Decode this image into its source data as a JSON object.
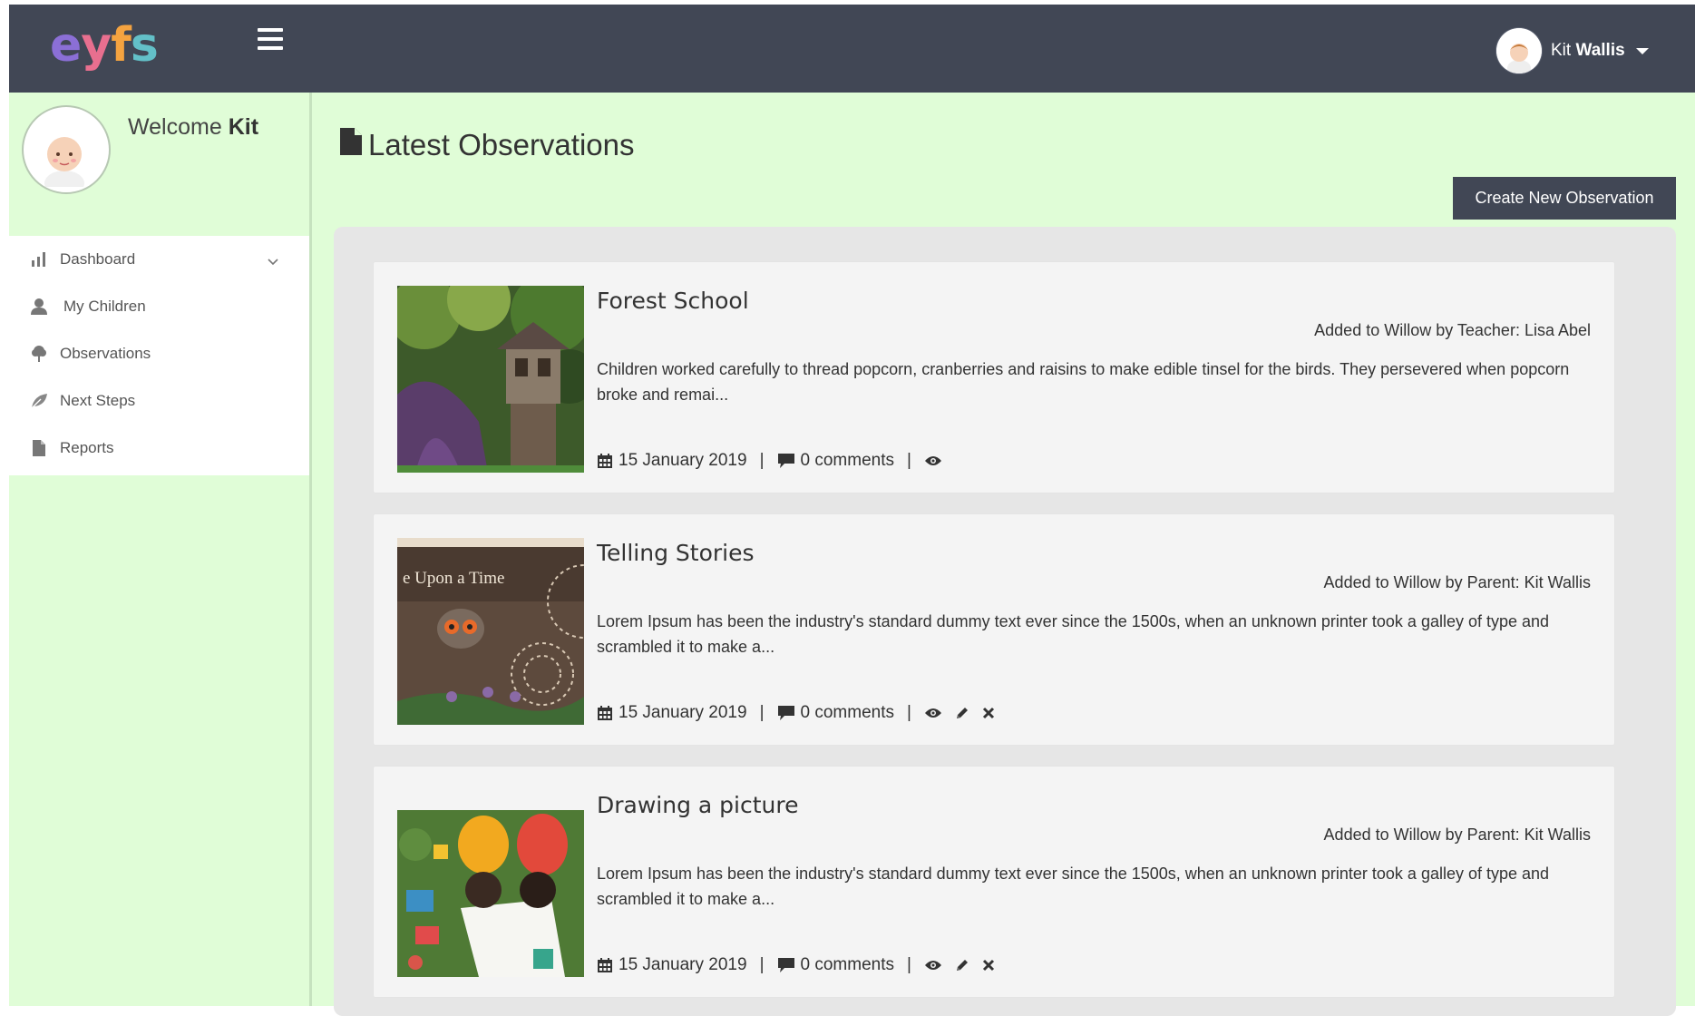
{
  "header": {
    "logo_letters": [
      "e",
      "y",
      "f",
      "s"
    ],
    "user_first": "Kit",
    "user_last": "Wallis"
  },
  "sidebar": {
    "welcome_prefix": "Welcome",
    "welcome_name": "Kit",
    "items": [
      {
        "label": "Dashboard",
        "icon": "bar-chart-icon"
      },
      {
        "label": "My Children",
        "icon": "user-icon"
      },
      {
        "label": "Observations",
        "icon": "tree-icon"
      },
      {
        "label": "Next Steps",
        "icon": "leaf-icon"
      },
      {
        "label": "Reports",
        "icon": "file-icon"
      }
    ]
  },
  "main": {
    "title": "Latest Observations",
    "create_button": "Create New Observation",
    "observations": [
      {
        "title": "Forest School",
        "author": "Added to Willow by Teacher: Lisa Abel",
        "description": "Children worked carefully to thread popcorn, cranberries and raisins to make edible tinsel for the birds. They persevered when popcorn broke and remai...",
        "date": "15 January 2019",
        "comments": "0 comments"
      },
      {
        "title": "Telling Stories",
        "author": "Added to Willow by Parent: Kit Wallis",
        "description": "Lorem Ipsum has been the industry's standard dummy text ever since the 1500s, when an unknown printer took a galley of type and scrambled it to make a...",
        "date": "15 January 2019",
        "comments": "0 comments",
        "thumb_text": "e Upon a Time"
      },
      {
        "title": "Drawing a picture",
        "author": "Added to Willow by Parent: Kit Wallis",
        "description": "Lorem Ipsum has been the industry's standard dummy text ever since the 1500s, when an unknown printer took a galley of type and scrambled it to make a...",
        "date": "15 January 2019",
        "comments": "0 comments"
      }
    ]
  },
  "colors": {
    "topbar": "#414755",
    "sidebar_bg": "#e0fdd7",
    "panel_bg": "#e6e6e6",
    "card_bg": "#f4f4f4"
  }
}
